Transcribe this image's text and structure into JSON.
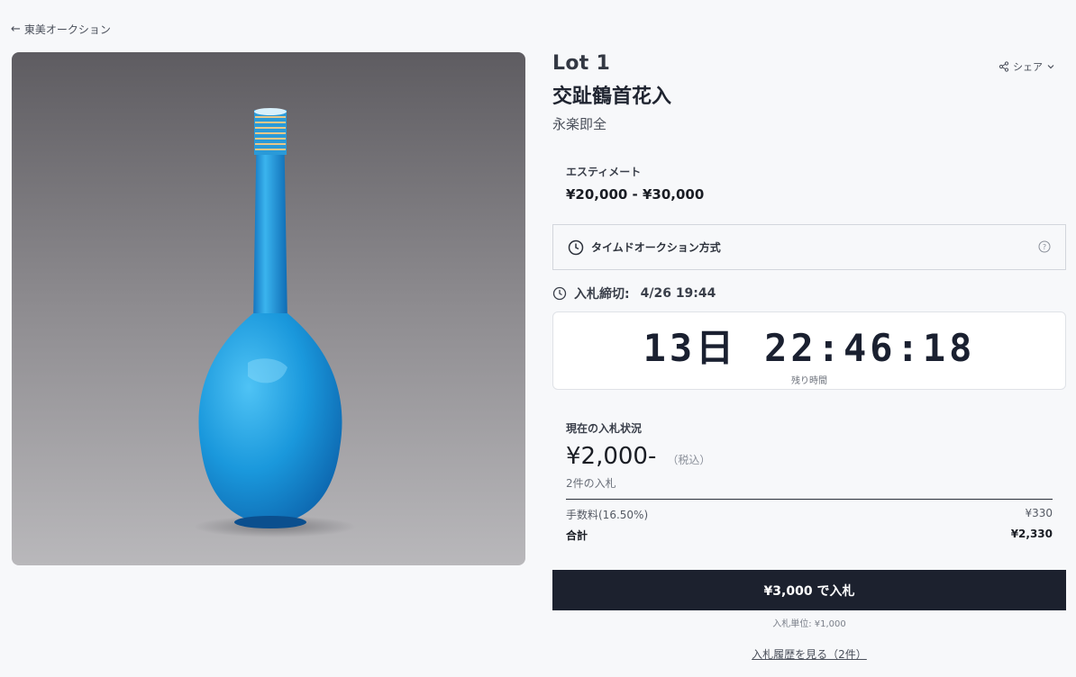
{
  "nav": {
    "back_label": "東美オークション"
  },
  "lot": {
    "number": "Lot 1",
    "title": "交趾鶴首花入",
    "artist": "永楽即全",
    "image_alt": "turquoise-vase-photo"
  },
  "share": {
    "label": "シェア"
  },
  "estimate": {
    "label": "エスティメート",
    "value": "¥20,000 - ¥30,000"
  },
  "auction_type": {
    "label": "タイムドオークション方式"
  },
  "deadline": {
    "label": "入札締切:",
    "value": "4/26 19:44"
  },
  "countdown": {
    "days": "13日",
    "time": "22:46:18",
    "remaining_label": "残り時間"
  },
  "bid_status": {
    "label": "現在の入札状況",
    "price": "¥2,000-",
    "tax_note": "（税込）",
    "bid_count": "2件の入札",
    "fee_label": "手数料(16.50%)",
    "fee_value": "¥330",
    "total_label": "合計",
    "total_value": "¥2,330"
  },
  "actions": {
    "bid_button": "¥3,000 で入札",
    "bid_unit": "入札単位: ¥1,000",
    "history_link": "入札履歴を見る（2件）"
  },
  "colors": {
    "primary_button": "#1c212e",
    "vase": "#1e9fe0",
    "background": "#f7f8fa"
  },
  "icons": [
    "back-arrow-icon",
    "share-icon",
    "chevron-down-icon",
    "clock-icon",
    "help-icon"
  ]
}
